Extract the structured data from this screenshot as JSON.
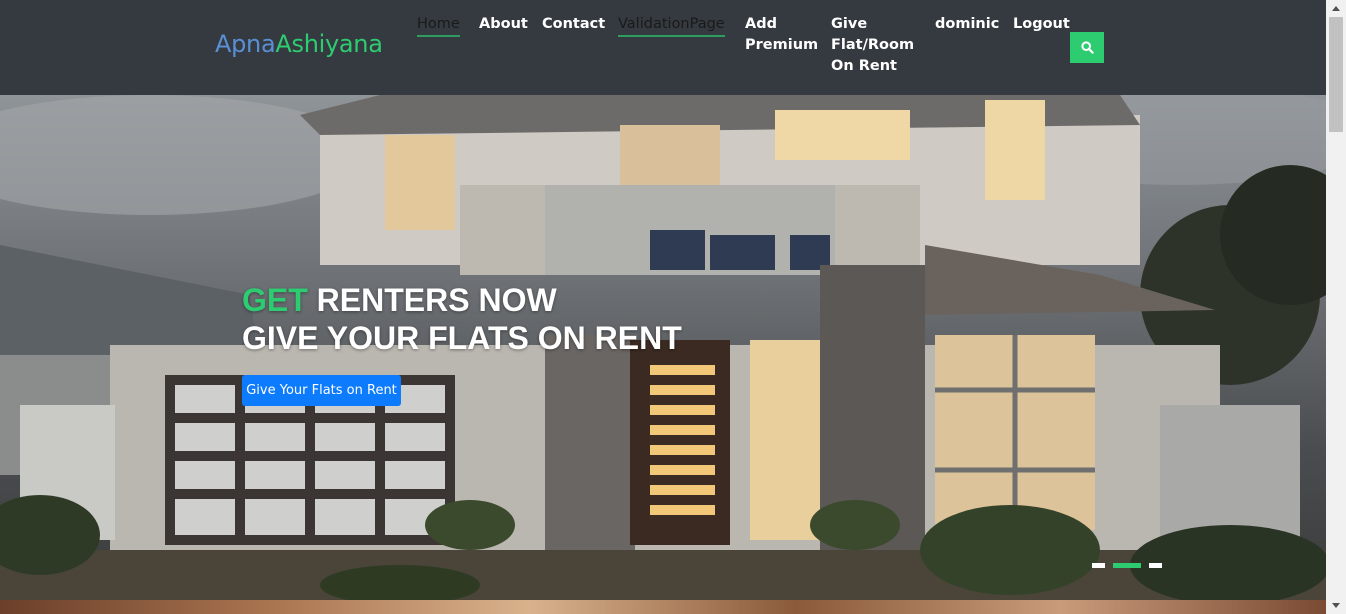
{
  "brand": {
    "part1": "Apna",
    "part2": "Ashiyana"
  },
  "nav": {
    "home": "Home",
    "about": "About",
    "contact": "Contact",
    "validation": "ValidationPage",
    "add_premium_l1": "Add",
    "add_premium_l2": "Premium",
    "give_l1": "Give",
    "give_l2": "Flat/Room",
    "give_l3": "On Rent",
    "user": "dominic",
    "logout": "Logout",
    "search_icon": "search-icon"
  },
  "hero": {
    "headline_accent": "GET",
    "headline_rest": " RENTERS NOW",
    "headline_line2": "GIVE YOUR FLATS ON RENT",
    "cta_label": "Give Your Flats on Rent",
    "slides_total": 3,
    "active_slide": 2
  },
  "colors": {
    "navbar_bg": "#343a40",
    "brand_blue": "#5a8fd6",
    "accent_green": "#2ecc71",
    "cta_blue": "#0d7bfd"
  }
}
